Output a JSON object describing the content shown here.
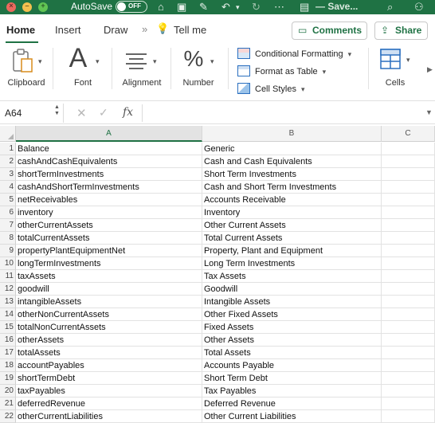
{
  "titlebar": {
    "autosave_label": "AutoSave",
    "autosave_state": "OFF",
    "doc_title": "— Save..."
  },
  "tabs": {
    "home": "Home",
    "insert": "Insert",
    "draw": "Draw",
    "chevron": "»",
    "tell_me": "Tell me"
  },
  "buttons": {
    "comments": "Comments",
    "share": "Share"
  },
  "ribbon": {
    "clipboard": "Clipboard",
    "font": "Font",
    "alignment": "Alignment",
    "number": "Number",
    "conditional_formatting": "Conditional Formatting",
    "format_as_table": "Format as Table",
    "cell_styles": "Cell Styles",
    "cells": "Cells",
    "font_glyph": "A",
    "number_glyph": "%"
  },
  "formula_bar": {
    "name_box": "A64",
    "fx": "fx",
    "formula": ""
  },
  "grid": {
    "columns": [
      "A",
      "B",
      "C"
    ],
    "rows": [
      {
        "num": "1",
        "a": "Balance",
        "b": "Generic"
      },
      {
        "num": "2",
        "a": "cashAndCashEquivalents",
        "b": "Cash and Cash Equivalents"
      },
      {
        "num": "3",
        "a": "shortTermInvestments",
        "b": "Short Term Investments"
      },
      {
        "num": "4",
        "a": "cashAndShortTermInvestments",
        "b": "Cash and Short Term Investments"
      },
      {
        "num": "5",
        "a": "netReceivables",
        "b": "Accounts Receivable"
      },
      {
        "num": "6",
        "a": "inventory",
        "b": "Inventory"
      },
      {
        "num": "7",
        "a": "otherCurrentAssets",
        "b": "Other Current Assets"
      },
      {
        "num": "8",
        "a": "totalCurrentAssets",
        "b": "Total Current Assets"
      },
      {
        "num": "9",
        "a": "propertyPlantEquipmentNet",
        "b": "Property, Plant and Equipment"
      },
      {
        "num": "10",
        "a": "longTermInvestments",
        "b": "Long Term Investments"
      },
      {
        "num": "11",
        "a": "taxAssets",
        "b": "Tax Assets"
      },
      {
        "num": "12",
        "a": "goodwill",
        "b": "Goodwill"
      },
      {
        "num": "13",
        "a": "intangibleAssets",
        "b": "Intangible Assets"
      },
      {
        "num": "14",
        "a": "otherNonCurrentAssets",
        "b": "Other Fixed Assets"
      },
      {
        "num": "15",
        "a": "totalNonCurrentAssets",
        "b": "Fixed Assets"
      },
      {
        "num": "16",
        "a": "otherAssets",
        "b": "Other Assets"
      },
      {
        "num": "17",
        "a": "totalAssets",
        "b": "Total Assets"
      },
      {
        "num": "18",
        "a": "accountPayables",
        "b": "Accounts Payable"
      },
      {
        "num": "19",
        "a": "shortTermDebt",
        "b": "Short Term Debt"
      },
      {
        "num": "20",
        "a": "taxPayables",
        "b": "Tax Payables"
      },
      {
        "num": "21",
        "a": "deferredRevenue",
        "b": "Deferred Revenue"
      },
      {
        "num": "22",
        "a": "otherCurrentLiabilities",
        "b": "Other Current Liabilities"
      }
    ]
  }
}
